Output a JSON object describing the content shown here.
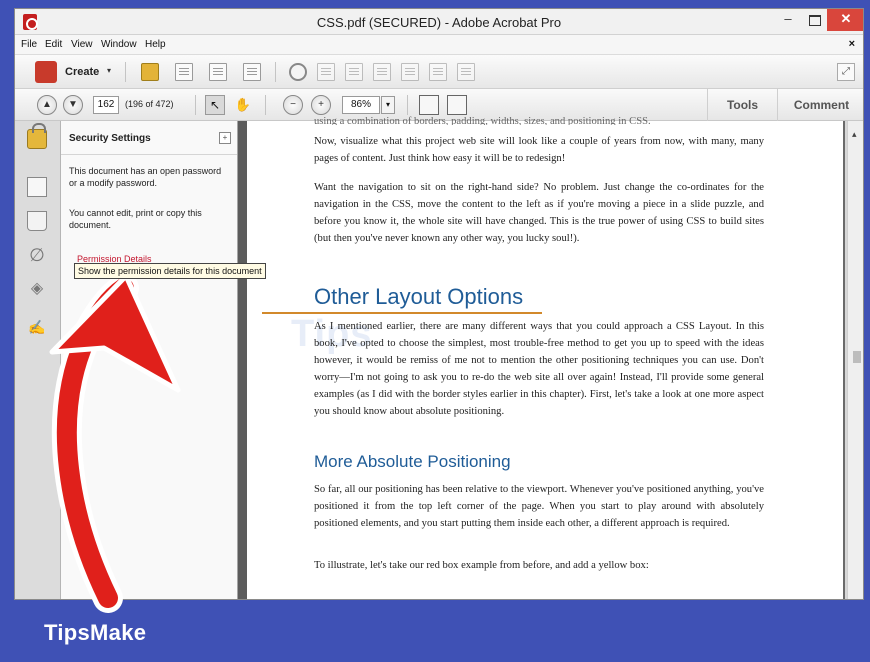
{
  "window": {
    "title": "CSS.pdf (SECURED) - Adobe Acrobat Pro",
    "controls": {
      "minimize": "–",
      "close": "✕"
    }
  },
  "menu": {
    "items": [
      "File",
      "Edit",
      "View",
      "Window",
      "Help"
    ],
    "close_glyph": "×"
  },
  "toolbar": {
    "create_label": "Create",
    "create_chevron": "▾",
    "expand_glyph": "⤢"
  },
  "nav_toolbar": {
    "prev_glyph": "▲",
    "next_glyph": "▼",
    "page_number": "162",
    "page_count": "(196 of 472)",
    "select_glyph": "↖",
    "hand_glyph": "✋",
    "zoom_out_glyph": "−",
    "zoom_in_glyph": "+",
    "zoom": "86%",
    "zoom_dropdown": "▾",
    "tools_label": "Tools",
    "comment_label": "Comment"
  },
  "left_nav": {
    "attach_glyph": "∅",
    "layers_glyph": "◈",
    "sign_glyph": "✍"
  },
  "security_panel": {
    "title": "Security Settings",
    "option_glyph": "+",
    "text1": "This document has an open password or a modify password.",
    "text2": "You cannot edit, print or copy this document.",
    "link": "Permission Details",
    "tooltip": "Show the permission details for this document",
    "cursor_glyph": "☝"
  },
  "document": {
    "cutoff": "using a combination of borders, padding, widths, sizes, and positioning in CSS.",
    "para1": "Now, visualize what this project web site will look like a couple of years from now, with many, many pages of content. Just think how easy it will be to redesign!",
    "para2": "Want the navigation to sit on the right-hand side? No problem. Just change the co-ordinates for the navigation in the CSS, move the content to the left as if you're moving a piece in a slide puzzle, and before you know it, the whole site will have changed. This is the true power of using CSS to build sites (but then you've never known any other way, you lucky soul!).",
    "heading1": "Other Layout Options",
    "para3": "As I mentioned earlier, there are many different ways that you could approach a CSS Layout. In this book, I've opted to choose the simplest, most trouble-free method to get you up to speed with the ideas however, it would be remiss of me not to mention the other positioning techniques you can use. Don't worry—I'm not going to ask you to re-do the web site all over again! Instead, I'll provide some general examples (as I did with the border styles earlier in this chapter). First, let's take a look at one more aspect you should know about absolute positioning.",
    "heading2": "More Absolute Positioning",
    "para4": "So far, all our positioning has been relative to the viewport. Whenever you've positioned anything, you've positioned it from the top left corner of the page. When you start to play around with absolutely positioned elements, and you start putting them inside each other, a different approach is required.",
    "para5": "To illustrate, let's take our red box example from before, and add a yellow box:",
    "watermark": "Tips"
  },
  "scrollbar": {
    "up_glyph": "▴"
  },
  "brand": {
    "name": "TipsMake"
  },
  "colors": {
    "frame": "#3f51b5",
    "arrow": "#e0201b",
    "heading": "#1f5c97",
    "link": "#c4162e",
    "close_button": "#d9463c"
  }
}
